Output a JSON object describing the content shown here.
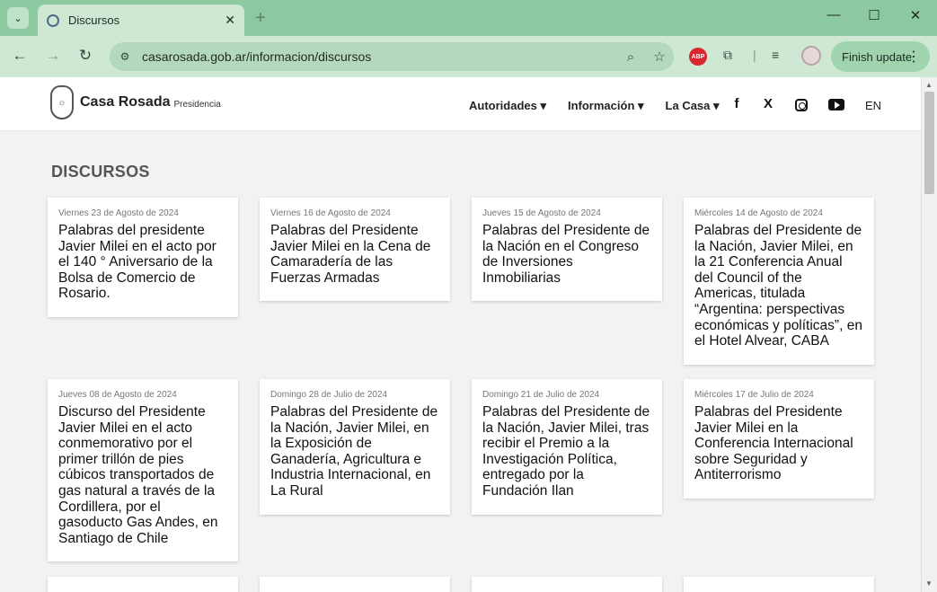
{
  "browser": {
    "tab_title": "Discursos",
    "url": "casarosada.gob.ar/informacion/discursos",
    "finish_update_label": "Finish update",
    "abp_label": "ABP"
  },
  "site": {
    "brand": "Casa Rosada",
    "brand_sub": "Presidencia",
    "nav": [
      "Autoridades",
      "Información",
      "La Casa"
    ],
    "lang": "EN"
  },
  "page": {
    "section_title": "DISCURSOS",
    "cards": [
      {
        "date": "Viernes 23 de Agosto de 2024",
        "title": "Palabras del presidente Javier Milei en el acto por el 140 ° Aniversario de la Bolsa de Comercio de Rosario."
      },
      {
        "date": "Viernes 16 de Agosto de 2024",
        "title": "Palabras del Presidente Javier Milei en la Cena de Camaradería de las Fuerzas Armadas"
      },
      {
        "date": "Jueves 15 de Agosto de 2024",
        "title": "Palabras del Presidente de la Nación en el Congreso de Inversiones Inmobiliarias"
      },
      {
        "date": "Miércoles 14 de Agosto de 2024",
        "title": "Palabras del Presidente de la Nación, Javier Milei, en la 21 Conferencia Anual del Council of the Americas, titulada “Argentina: perspectivas económicas y políticas”, en el Hotel Alvear, CABA"
      },
      {
        "date": "Jueves 08 de Agosto de 2024",
        "title": "Discurso del Presidente Javier Milei en el acto conmemorativo por el primer trillón de pies cúbicos transportados de gas natural a través de la Cordillera, por el gasoducto Gas Andes, en Santiago de Chile"
      },
      {
        "date": "Domingo 28 de Julio de 2024",
        "title": "Palabras del Presidente de la Nación, Javier Milei, en la Exposición de Ganadería, Agricultura e Industria Internacional, en La Rural"
      },
      {
        "date": "Domingo 21 de Julio de 2024",
        "title": "Palabras del Presidente de la Nación, Javier Milei, tras recibir el Premio a la Investigación Política, entregado por la Fundación Ilan"
      },
      {
        "date": "Miércoles 17 de Julio de 2024",
        "title": "Palabras del Presidente Javier Milei en la Conferencia Internacional sobre Seguridad y Antiterrorismo"
      }
    ]
  }
}
